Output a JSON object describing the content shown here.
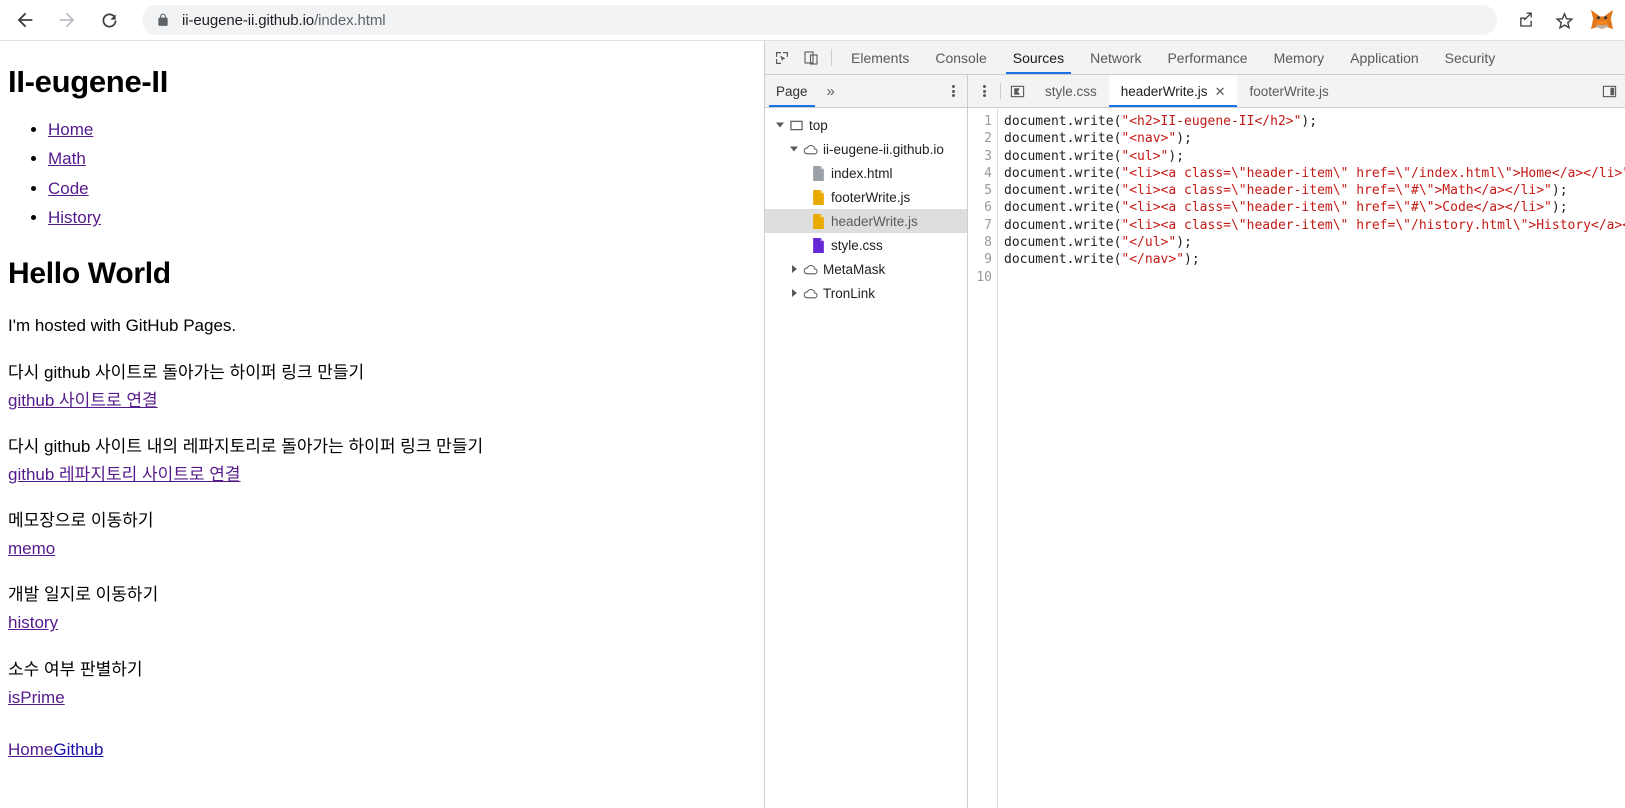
{
  "browser": {
    "back_icon": "arrow-left-icon",
    "forward_icon": "arrow-right-icon",
    "reload_icon": "reload-icon",
    "lock_icon": "lock-icon",
    "url_domain": "ii-eugene-ii.github.io",
    "url_path": "/index.html",
    "url_full": "ii-eugene-ii.github.io/index.html",
    "share_icon": "share-icon",
    "bookmark_icon": "star-icon",
    "extension_icon": "metamask-fox-icon"
  },
  "page": {
    "site_title": "II-eugene-II",
    "nav_items": [
      {
        "label": "Home"
      },
      {
        "label": "Math"
      },
      {
        "label": "Code"
      },
      {
        "label": "History"
      }
    ],
    "heading": "Hello World",
    "intro": "I'm hosted with GitHub Pages.",
    "sections": [
      {
        "text": "다시 github 사이트로 돌아가는 하이퍼 링크 만들기",
        "link": "github 사이트로 연결"
      },
      {
        "text": "다시 github 사이트 내의 레파지토리로 돌아가는 하이퍼 링크 만들기",
        "link": "github 레파지토리 사이트로 연결"
      },
      {
        "text": "메모장으로 이동하기",
        "link": "memo"
      },
      {
        "text": "개발 일지로 이동하기",
        "link": "history"
      },
      {
        "text": "소수 여부 판별하기",
        "link": "isPrime"
      }
    ],
    "footer": {
      "home_link": "Home",
      "github_link": "Github"
    },
    "link_color_visited": "#551a8b",
    "link_color_unvisited": "#1a0dab"
  },
  "devtools": {
    "inspect_icon": "inspect-element-icon",
    "device_toolbar_icon": "device-toolbar-icon",
    "tabs": [
      {
        "label": "Elements",
        "active": false
      },
      {
        "label": "Console",
        "active": false
      },
      {
        "label": "Sources",
        "active": true
      },
      {
        "label": "Network",
        "active": false
      },
      {
        "label": "Performance",
        "active": false
      },
      {
        "label": "Memory",
        "active": false
      },
      {
        "label": "Application",
        "active": false
      },
      {
        "label": "Security",
        "active": false
      }
    ],
    "active_tab_color": "#1a73e8",
    "navigator": {
      "tab_label": "Page",
      "more_tabs_icon": "chevron-double-right-icon",
      "menu_icon": "kebab-menu-icon",
      "tree": [
        {
          "label": "top",
          "icon": "frame-icon",
          "depth": 0,
          "twisty": "expanded",
          "selected": false
        },
        {
          "label": "ii-eugene-ii.github.io",
          "icon": "cloud-icon",
          "depth": 1,
          "twisty": "expanded",
          "selected": false
        },
        {
          "label": "index.html",
          "icon": "document-gray-icon",
          "depth": 2,
          "twisty": "none",
          "selected": false
        },
        {
          "label": "footerWrite.js",
          "icon": "document-yellow-icon",
          "depth": 2,
          "twisty": "none",
          "selected": false
        },
        {
          "label": "headerWrite.js",
          "icon": "document-yellow-icon",
          "depth": 2,
          "twisty": "none",
          "selected": true
        },
        {
          "label": "style.css",
          "icon": "document-purple-icon",
          "depth": 2,
          "twisty": "none",
          "selected": false
        },
        {
          "label": "MetaMask",
          "icon": "cloud-icon",
          "depth": 1,
          "twisty": "collapsed",
          "selected": false
        },
        {
          "label": "TronLink",
          "icon": "cloud-icon",
          "depth": 1,
          "twisty": "collapsed",
          "selected": false
        }
      ]
    },
    "editor": {
      "navigator_toggle_icon": "show-navigator-icon",
      "overflow_icon": "panel-right-icon",
      "tabs": [
        {
          "label": "style.css",
          "active": false,
          "closable": false
        },
        {
          "label": "headerWrite.js",
          "active": true,
          "closable": true
        },
        {
          "label": "footerWrite.js",
          "active": false,
          "closable": false
        }
      ],
      "close_glyph": "✕",
      "line_numbers": [
        "1",
        "2",
        "3",
        "4",
        "5",
        "6",
        "7",
        "8",
        "9",
        "10"
      ],
      "code_lines": [
        {
          "n": 1,
          "pre": "document.write(",
          "str": "\"<h2>II-eugene-II</h2>\"",
          "post": ");"
        },
        {
          "n": 2,
          "pre": "document.write(",
          "str": "\"<nav>\"",
          "post": ");"
        },
        {
          "n": 3,
          "pre": "document.write(",
          "str": "\"<ul>\"",
          "post": ");"
        },
        {
          "n": 4,
          "pre": "document.write(",
          "str": "\"<li><a class=\\\"header-item\\\" href=\\\"/index.html\\\">Home</a></li>\"",
          "post": ");"
        },
        {
          "n": 5,
          "pre": "document.write(",
          "str": "\"<li><a class=\\\"header-item\\\" href=\\\"#\\\">Math</a></li>\"",
          "post": ");"
        },
        {
          "n": 6,
          "pre": "document.write(",
          "str": "\"<li><a class=\\\"header-item\\\" href=\\\"#\\\">Code</a></li>\"",
          "post": ");"
        },
        {
          "n": 7,
          "pre": "document.write(",
          "str": "\"<li><a class=\\\"header-item\\\" href=\\\"/history.html\\\">History</a></li>\"",
          "post": ");"
        },
        {
          "n": 8,
          "pre": "document.write(",
          "str": "\"</ul>\"",
          "post": ");"
        },
        {
          "n": 9,
          "pre": "document.write(",
          "str": "\"</nav>\"",
          "post": ");"
        },
        {
          "n": 10,
          "pre": "",
          "str": "",
          "post": ""
        }
      ],
      "string_color": "#c41a16",
      "plain_color": "#202124"
    }
  }
}
